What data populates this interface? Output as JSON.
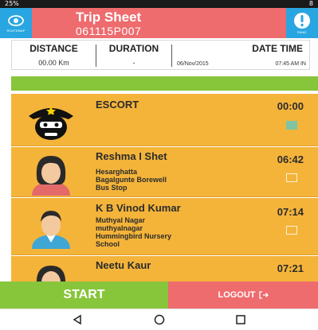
{
  "status_bar": {
    "left": "25%",
    "right": "8"
  },
  "header": {
    "title": "Trip Sheet",
    "subtitle": "061115P007",
    "left_button_label": "ROUTEMAP",
    "right_button_label": "PANIC"
  },
  "summary": {
    "distance_label": "DISTANCE",
    "distance_value": "00.00 Km",
    "duration_label": "DURATION",
    "duration_value": "-",
    "datetime_label": "DATE TIME",
    "date_value": "06/Nov/2015",
    "time_value": "07:45 AM IN"
  },
  "trip_list": [
    {
      "name": "ESCORT",
      "address": [],
      "time": "00:00",
      "checked": true,
      "avatar": "escort-guard"
    },
    {
      "name": "Reshma I Shet",
      "address": [
        "Hesarghatta",
        "Bagalgunte Borewell",
        "Bus Stop"
      ],
      "time": "06:42",
      "checked": false,
      "avatar": "female"
    },
    {
      "name": "K B Vinod Kumar",
      "address": [
        "Muthyal Nagar",
        "muthyalnagar",
        "Hummingbird Nursery",
        "School"
      ],
      "time": "07:14",
      "checked": false,
      "avatar": "male"
    },
    {
      "name": "Neetu Kaur",
      "address": [],
      "time": "07:21",
      "checked": false,
      "avatar": "female"
    }
  ],
  "actions": {
    "start_label": "START",
    "logout_label": "LOGOUT"
  },
  "colors": {
    "header": "#ee6b6e",
    "header_buttons": "#29a6e1",
    "card": "#f4b43a",
    "green": "#87c53b",
    "logout": "#ee6b6e"
  }
}
